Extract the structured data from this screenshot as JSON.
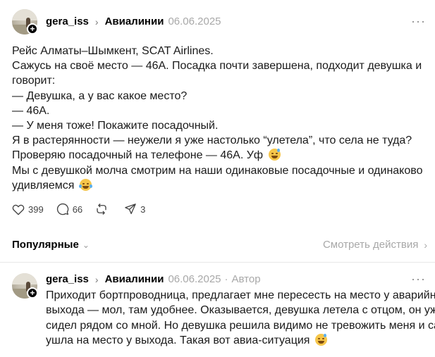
{
  "post": {
    "author": "gera_iss",
    "separator": "›",
    "topic": "Авиалинии",
    "date": "06.06.2025",
    "more": "···",
    "lines": [
      "Рейс Алматы–Шымкент, SCAT Airlines.",
      "Сажусь на своё место — 46А. Посадка почти завершена, подходит девушка и",
      "говорит:",
      "— Девушка, а у вас какое место?",
      "— 46А.",
      "— У меня тоже! Покажите посадочный.",
      "Я в растерянности — неужели я уже настолько “улетела”, что села не туда?",
      "Проверяю посадочный на телефоне — 46А. Уф",
      "Мы с девушкой молча смотрим на наши одинаковые посадочные и одинаково",
      "удивляемся"
    ],
    "actions": {
      "likes": "399",
      "comments": "66",
      "shares": "3"
    }
  },
  "popular": {
    "label": "Популярные",
    "caret": "⌄",
    "see_actions": "Смотреть действия",
    "arrow": "›"
  },
  "comment": {
    "author": "gera_iss",
    "separator": "›",
    "topic": "Авиалинии",
    "date": "06.06.2025",
    "dot": "·",
    "role": "Автор",
    "more": "···",
    "lines": [
      "Приходит бортпроводница, предлагает мне пересесть на место у аварийного",
      "выхода — мол, там удобнее. Оказывается, девушка летела с отцом, он уже",
      "сидел рядом со мной. Но девушка решила видимо не тревожить меня и сама",
      "ушла на место у выхода. Такая вот авиа-ситуация"
    ]
  },
  "icons": {
    "avatar_badge": "plus-icon",
    "like": "heart-icon",
    "comment": "comment-bubble-icon",
    "repost": "repost-icon",
    "share": "send-icon",
    "emoji_sweat": "sweat-smile-emoji",
    "emoji_tears": "tears-of-joy-emoji"
  },
  "colors": {
    "meta_gray": "#a8a8a8",
    "text": "#1a1a1a",
    "divider": "#e8e8e8"
  }
}
